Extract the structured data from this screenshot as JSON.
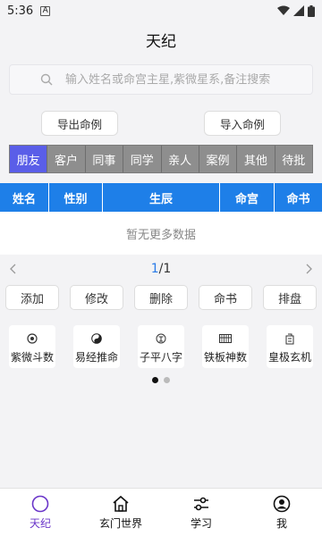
{
  "status_bar": {
    "time": "5:36",
    "a_icon": "A"
  },
  "header": {
    "title": "天纪"
  },
  "search": {
    "placeholder": "输入姓名或命宫主星,紫微星系,备注搜索"
  },
  "io_buttons": {
    "export": "导出命例",
    "import": "导入命例"
  },
  "tabs": [
    {
      "label": "朋友",
      "active": true
    },
    {
      "label": "客户"
    },
    {
      "label": "同事"
    },
    {
      "label": "同学"
    },
    {
      "label": "亲人"
    },
    {
      "label": "案例"
    },
    {
      "label": "其他"
    },
    {
      "label": "待批"
    }
  ],
  "table": {
    "columns": [
      "姓名",
      "性别",
      "生辰",
      "命宫",
      "命书"
    ],
    "empty_text": "暂无更多数据"
  },
  "pager": {
    "current": "1",
    "total": "/1"
  },
  "actions": [
    "添加",
    "修改",
    "删除",
    "命书",
    "排盘"
  ],
  "features": [
    {
      "label": "紫微斗数",
      "icon": "ziwei-icon"
    },
    {
      "label": "易经推命",
      "icon": "yinyang-icon"
    },
    {
      "label": "子平八字",
      "icon": "bazi-icon"
    },
    {
      "label": "铁板神数",
      "icon": "abacus-icon"
    },
    {
      "label": "皇极玄机",
      "icon": "huangji-icon"
    }
  ],
  "bottom_nav": [
    {
      "label": "天纪",
      "icon": "circle-icon",
      "active": true
    },
    {
      "label": "玄门世界",
      "icon": "home-icon"
    },
    {
      "label": "学习",
      "icon": "sliders-icon"
    },
    {
      "label": "我",
      "icon": "user-icon"
    }
  ],
  "colors": {
    "accent": "#5a5ee8",
    "header_blue": "#1e7fe8",
    "tab_gray": "#8e8e8e",
    "nav_active": "#6a35c9"
  }
}
